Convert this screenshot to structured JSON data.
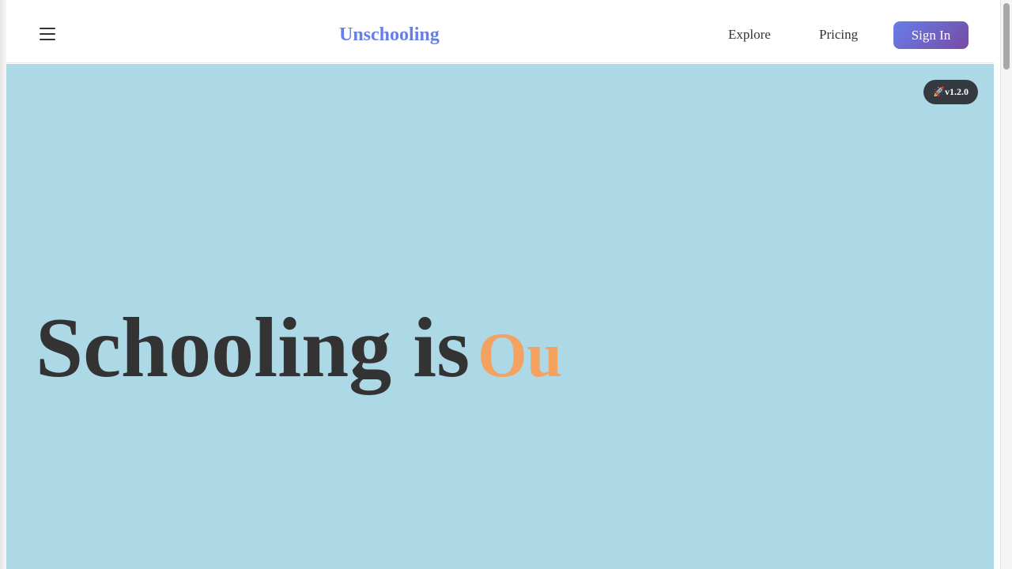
{
  "header": {
    "logo": "Unschooling",
    "nav": {
      "explore": "Explore",
      "pricing": "Pricing"
    },
    "signin_label": "Sign In",
    "menu_icon": "hamburger-menu-icon"
  },
  "hero": {
    "badge": "🚀v1.2.0",
    "title_main": "Schooling is",
    "title_accent": "Ou"
  },
  "colors": {
    "brand": "#667eea",
    "button_gradient_start": "#667eea",
    "button_gradient_end": "#764ba2",
    "hero_background": "#add8e6",
    "heading_text": "#333333",
    "accent_text": "#f4a261",
    "badge_background": "#343a40"
  }
}
